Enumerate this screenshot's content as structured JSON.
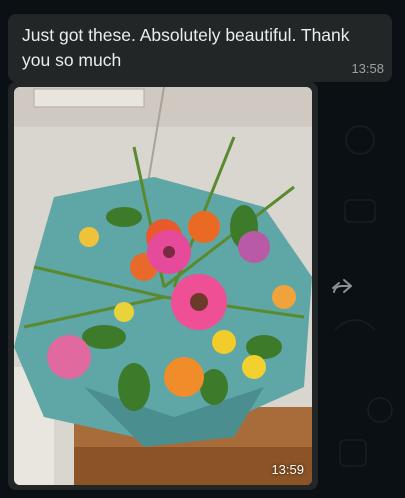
{
  "message_text": {
    "text": "Just got these. Absolutely beautiful. Thank you so much",
    "time": "13:58"
  },
  "message_image": {
    "time": "13:59"
  },
  "forward_icon": "forward-arrow-icon",
  "colors": {
    "background": "#0b1014",
    "bubble": "#232626",
    "text": "#e9edef",
    "timestamp": "#9aa2a6"
  }
}
